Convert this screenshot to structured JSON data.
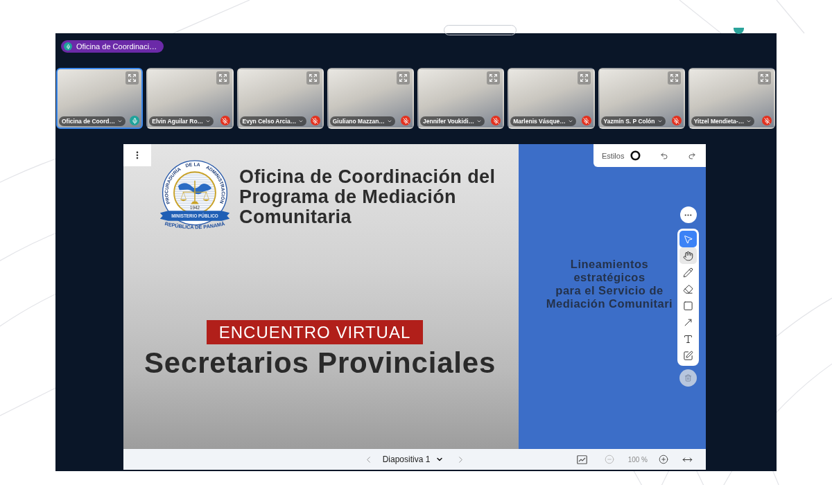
{
  "speaker": {
    "name": "Oficina de Coordinaci…"
  },
  "participants": [
    {
      "name": "Oficina de Coord…",
      "speaking": true,
      "muted": false
    },
    {
      "name": "Elvin Aguilar Ro…",
      "speaking": false,
      "muted": true
    },
    {
      "name": "Evyn Celso Arcia…",
      "speaking": false,
      "muted": true
    },
    {
      "name": "Giuliano Mazzan…",
      "speaking": false,
      "muted": true
    },
    {
      "name": "Jennifer Voukidi…",
      "speaking": false,
      "muted": true
    },
    {
      "name": "Marlenis Vásque…",
      "speaking": false,
      "muted": true
    },
    {
      "name": "Yazmín S. P Colón",
      "speaking": false,
      "muted": true
    },
    {
      "name": "Yitzel Mendieta-…",
      "speaking": false,
      "muted": true
    }
  ],
  "slide": {
    "logo": {
      "arc_words": [
        "PROCURADURÍA",
        "DE LA",
        "ADMINISTRACIÓN"
      ],
      "year": "1942",
      "ribbon": "MINISTERIO PÚBLICO",
      "bottom_text": "REPÚBLICA DE PANAMÁ"
    },
    "title_lines": [
      "Oficina de Coordinación del",
      "Programa de Mediación",
      "Comunitaria"
    ],
    "banner": "ENCUENTRO VIRTUAL",
    "headline": "Secretarios Provinciales",
    "side_text_lines": [
      "Lineamientos",
      "estratégicos",
      "para el Servicio de",
      "Mediación Comunitari"
    ]
  },
  "annotation_bar": {
    "styles_label": "Estilos"
  },
  "tools": [
    {
      "kind": "select",
      "selected": true,
      "hovered": false
    },
    {
      "kind": "hand",
      "selected": false,
      "hovered": true
    },
    {
      "kind": "pencil",
      "selected": false,
      "hovered": false
    },
    {
      "kind": "eraser",
      "selected": false,
      "hovered": false
    },
    {
      "kind": "rectangle",
      "selected": false,
      "hovered": false
    },
    {
      "kind": "arrow",
      "selected": false,
      "hovered": false
    },
    {
      "kind": "text",
      "selected": false,
      "hovered": false
    },
    {
      "kind": "note",
      "selected": false,
      "hovered": false
    }
  ],
  "trash": {
    "disabled": true
  },
  "footer": {
    "slide_label": "Diapositiva 1",
    "zoom": "100 %",
    "zoom_out_disabled": true
  }
}
